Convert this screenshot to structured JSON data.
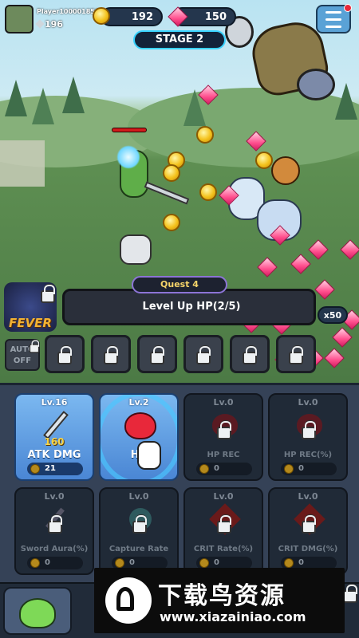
{
  "hud": {
    "player_name": "Player100001850",
    "power": "196",
    "gold": "192",
    "gems": "150",
    "stage": "STAGE 2"
  },
  "quest": {
    "title": "Quest 4",
    "text": "Level Up HP(2/5)"
  },
  "fever": {
    "label": "FEVER"
  },
  "auto": {
    "line1": "AUTO",
    "line2": "OFF"
  },
  "drops": {
    "gem_count": "x50"
  },
  "upgrades": [
    {
      "level": "Lv.16",
      "name": "ATK DMG",
      "cost": "21",
      "bonus": "160",
      "icon": "sword-icon"
    },
    {
      "level": "Lv.2",
      "name": "HP",
      "cost": "",
      "bonus": "",
      "icon": "heart-icon"
    },
    {
      "level": "Lv.0",
      "name": "HP REC",
      "cost": "0",
      "icon": "heart-icon"
    },
    {
      "level": "Lv.0",
      "name": "HP REC(%)",
      "cost": "0",
      "icon": "heart-icon"
    },
    {
      "level": "Lv.0",
      "name": "Sword Aura(%)",
      "cost": "0",
      "icon": "sword-icon"
    },
    {
      "level": "Lv.0",
      "name": "Capture Rate",
      "cost": "0",
      "icon": "orb-icon"
    },
    {
      "level": "Lv.0",
      "name": "CRIT Rate(%)",
      "cost": "0",
      "icon": "burst-icon"
    },
    {
      "level": "Lv.0",
      "name": "CRIT DMG(%)",
      "cost": "0",
      "icon": "burst-icon"
    }
  ],
  "watermark": {
    "title": "下载鸟资源",
    "url": "www.xiazainiao.com"
  },
  "colors": {
    "accent": "#39d3ff",
    "gold": "#f4c21c",
    "gem": "#ff4f8e",
    "panel": "#354257"
  }
}
